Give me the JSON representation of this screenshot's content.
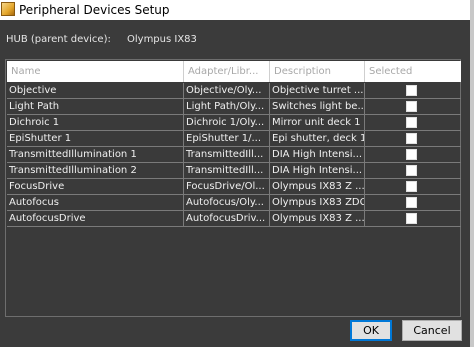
{
  "window": {
    "title": "Peripheral Devices Setup"
  },
  "hub": {
    "label": "HUB (parent device):",
    "value": "Olympus IX83"
  },
  "table": {
    "columns": [
      "Name",
      "Adapter/Libr...",
      "Description",
      "Selected"
    ],
    "rows": [
      {
        "name": "Objective",
        "adapter": "Objective/Oly...",
        "description": "Objective turret ...",
        "selected": false
      },
      {
        "name": "Light Path",
        "adapter": "Light Path/Oly...",
        "description": "Switches light be...",
        "selected": false
      },
      {
        "name": "Dichroic 1",
        "adapter": "Dichroic 1/Oly...",
        "description": "Mirror unit deck 1",
        "selected": false
      },
      {
        "name": "EpiShutter 1",
        "adapter": "EpiShutter 1/...",
        "description": "Epi shutter, deck 1",
        "selected": false
      },
      {
        "name": "TransmittedIllumination 1",
        "adapter": "TransmittedIll...",
        "description": "DIA High Intensi...",
        "selected": false
      },
      {
        "name": "TransmittedIllumination 2",
        "adapter": "TransmittedIll...",
        "description": "DIA High Intensi...",
        "selected": false
      },
      {
        "name": "FocusDrive",
        "adapter": "FocusDrive/Ol...",
        "description": "Olympus IX83 Z ...",
        "selected": false
      },
      {
        "name": "Autofocus",
        "adapter": "Autofocus/Oly...",
        "description": "Olympus IX83 ZDC",
        "selected": false
      },
      {
        "name": "AutofocusDrive",
        "adapter": "AutofocusDriv...",
        "description": "Olympus IX83 Z ...",
        "selected": false
      }
    ]
  },
  "buttons": {
    "ok": "OK",
    "cancel": "Cancel"
  }
}
